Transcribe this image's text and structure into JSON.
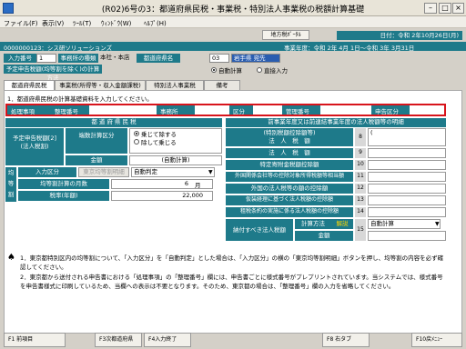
{
  "window": {
    "title": "(R02)6号の3：都道府県民税・事業税・特別法人事業税の税額計算基礎"
  },
  "menus": [
    "ファイル(F)",
    "表示(V)",
    "ﾂｰﾙ(T)",
    "ｳｨﾝﾄﾞｳ(W)",
    "ﾍﾙﾌﾟ(H)"
  ],
  "toolbar_buttons": [
    "地方税ﾎﾟｰﾀﾙ"
  ],
  "date_display": "日付：令和 2年10月26日(月)",
  "company_bar": {
    "code_name": "0000000123：シス研ソリューションズ",
    "period": "事業年度：令和 2年 4月 1日～令和 3年 3月31日"
  },
  "input": {
    "input_no_label": "入力番号",
    "input_no": "1",
    "office_type_label": "事務所の種類",
    "office_type": "本社・本店",
    "pref_label": "都道府県名",
    "pref_code": "03",
    "pref_name": "岩手県 宛先"
  },
  "calc": {
    "label": "予定申告税額(均等割を除く)の計算方法",
    "options": [
      "自動計算",
      "直接入力"
    ],
    "selected": 0
  },
  "tabs": [
    "都道府県民税",
    "事業税(所得等・収入金額課税)",
    "特別法人事業税",
    "備考"
  ],
  "notice": "1．都道府県民税の計算基礎資料を入力してください。",
  "office_row": {
    "labels": [
      "処理事項",
      "整理番号",
      "事務所",
      "区分",
      "管理番号",
      "申告区分"
    ]
  },
  "left": {
    "header": "都 道 府 県 民 税",
    "yotei_label": "予定申告税額[2]\n(法人税割)",
    "shinsei_label": "端数計算区分",
    "radio_options": [
      "乗じて除する",
      "除して乗じる"
    ],
    "kingaku_label": "金額",
    "kingaku_value": "(自動計算)",
    "kintou_chars": [
      "均",
      "等",
      "割"
    ],
    "input_kubun_label": "入力区分",
    "input_kubun_value": "東京均等割明細",
    "input_kubun_select": "自動判定",
    "months_label": "均等割計算の月数",
    "months_value": "6",
    "months_unit": "月",
    "zeiritsu_label": "税率(年額)",
    "zeiritsu_value": "22,000"
  },
  "right": {
    "header": "前事業年度又は前連結事業年度の法人税額等の明細",
    "rows": [
      {
        "num": "8",
        "label": "(特別税額控除額等)\n法　人　税　額",
        "value": "("
      },
      {
        "num": "9",
        "label": "法　人　税　額",
        "value": ""
      },
      {
        "num": "10",
        "label": "特定寄附金税額控除額",
        "value": ""
      },
      {
        "num": "11",
        "label": "外国関係会社等の控除対象所得税額等相当額",
        "value": ""
      },
      {
        "num": "12",
        "label": "外国の法人税等の額の控除額",
        "value": ""
      },
      {
        "num": "13",
        "label": "仮装経理に基づく法人税額の控除額",
        "value": ""
      },
      {
        "num": "14",
        "label": "租税条約の実施に係る法人税額の控除額",
        "value": ""
      }
    ],
    "nouzei_label": "納付すべき法人税額",
    "calc_method_label": "計算方法",
    "calc_method_badge": "解説",
    "calc_method_value": "自動計算",
    "kingaku_label": "金額",
    "num15": "15"
  },
  "footnotes": [
    "1．東京都特別区内の均等割について、「入力区分」を「自動判定」とした場合は、「入力区分」の横の「東京均等割明細」ボタンを押し、均等割の内容を必ず確認してください。",
    "2．東京都から送付される申告書における「処理事項」の「整理番号」欄には、申告書ごとに様式番号がプレプリントされています。当システムでは、様式番号を申告書様式に印刷しているため、当欄への表示は不要となります。そのため、東京都の場合は、「整理番号」欄の入力を省略してください。"
  ],
  "fkeys": [
    "F1 前項目",
    "F3次都道府県",
    "F4入力終了",
    "F8 右タブ",
    "F10戻ﾒﾆｭｰ"
  ]
}
